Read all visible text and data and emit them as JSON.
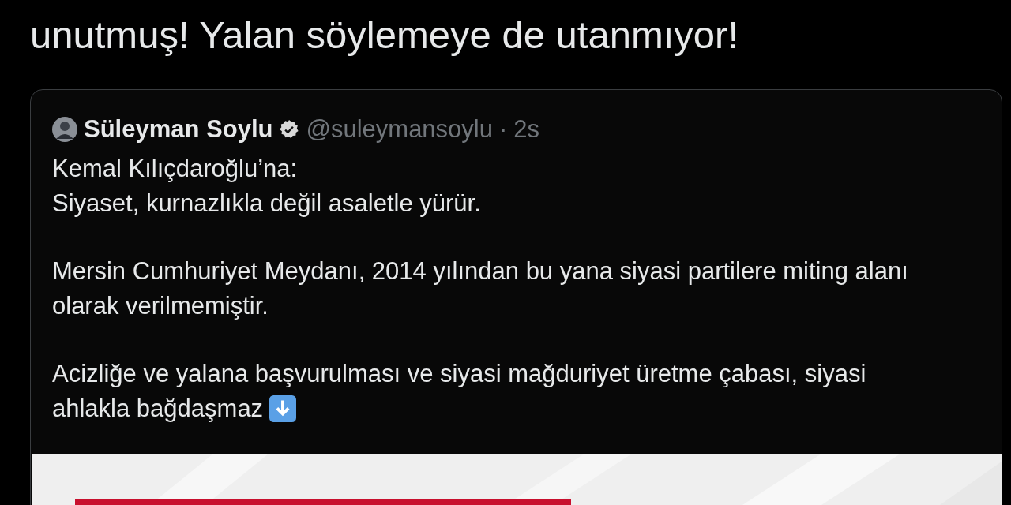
{
  "tweet": {
    "text_lines": [
      "unutmuş! Yalan söylemeye de utanmıyor!"
    ]
  },
  "quoted_tweet": {
    "author": "Süleyman Soylu",
    "verified": true,
    "handle": "@suleymansoylu",
    "separator": "·",
    "time": "2s",
    "paragraphs": [
      [
        "Kemal Kılıçdaroğlu’na:",
        "Siyaset, kurnazlıkla değil asaletle yürür."
      ],
      [
        "Mersin Cumhuriyet Meydanı, 2014 yılından bu yana siyasi partilere miting alanı",
        "olarak verilmemiştir."
      ],
      [
        "Acizliğe ve yalana başvurulması ve siyasi mağduriyet üretme çabası, siyasi",
        "ahlakla bağdaşmaz"
      ]
    ],
    "media": {
      "kind": "picture"
    }
  }
}
